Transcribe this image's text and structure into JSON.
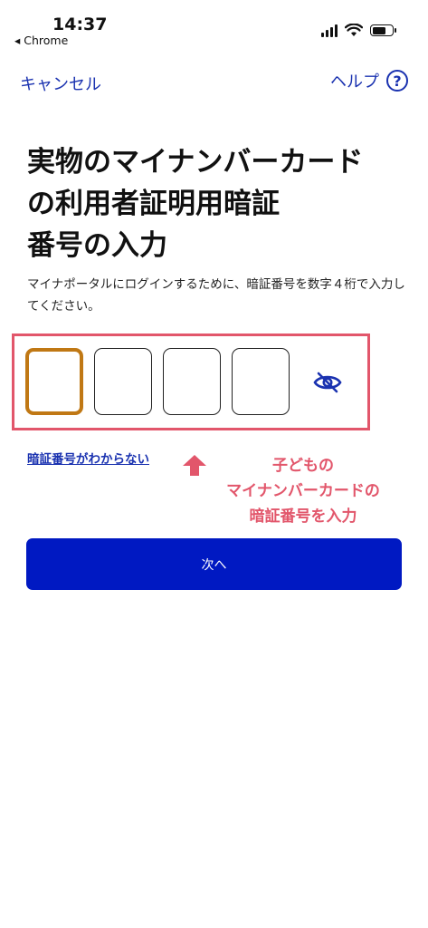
{
  "status_bar": {
    "time": "14:37",
    "back_app": "◂ Chrome"
  },
  "nav": {
    "cancel_label": "キャンセル",
    "help_label": "ヘルプ",
    "help_icon_glyph": "?"
  },
  "page": {
    "title_lines": [
      "実物のマイナンバーカード",
      "の利用者証明用暗証",
      "番号の入力"
    ],
    "description": "マイナポータルにログインするために、暗証番号を数字４桁で入力してください。"
  },
  "pin": {
    "digits": [
      "",
      "",
      "",
      ""
    ],
    "active_index": 0,
    "visibility_icon": "eye-off-icon"
  },
  "forgot_link": "暗証番号がわからない",
  "annotation": {
    "lines": [
      "子どもの",
      "マイナンバーカードの",
      "暗証番号を入力"
    ]
  },
  "next_button": "次へ",
  "colors": {
    "accent": "#1a32b0",
    "primary_button": "#0019c2",
    "annotation": "#e2566b",
    "active_box": "#c07814"
  }
}
